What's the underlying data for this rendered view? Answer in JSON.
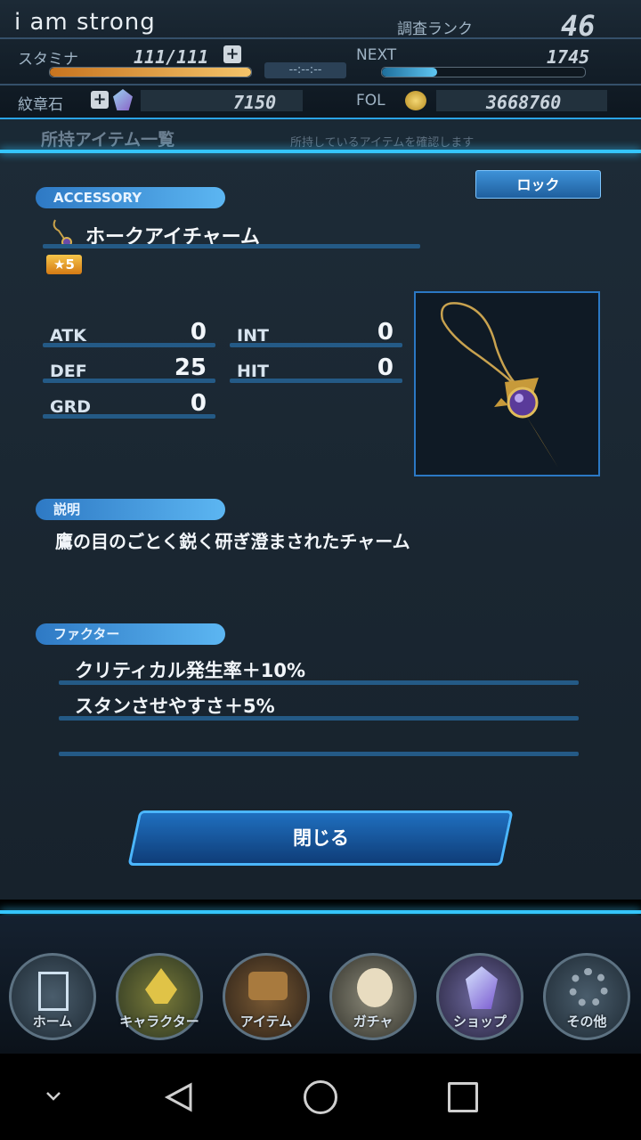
{
  "header": {
    "player_name": "i am strong",
    "rank_label": "調査ランク",
    "rank_value": "46",
    "stamina_label": "スタミナ",
    "stamina_value": "111/111",
    "next_label": "NEXT",
    "next_value": "1745",
    "timer": "--:--:--",
    "crest_label": "紋章石",
    "crest_value": "7150",
    "fol_label": "FOL",
    "fol_value": "3668760",
    "bg_title": "所持アイテム一覧",
    "bg_hint": "所持しているアイテムを確認します"
  },
  "item": {
    "category": "ACCESSORY",
    "name": "ホークアイチャーム",
    "rarity": "5",
    "lock_label": "ロック",
    "stats": {
      "atk_label": "ATK",
      "atk": "0",
      "int_label": "INT",
      "int": "0",
      "def_label": "DEF",
      "def": "25",
      "hit_label": "HIT",
      "hit": "0",
      "grd_label": "GRD",
      "grd": "0"
    },
    "desc_label": "説明",
    "description": "鷹の目のごとく鋭く研ぎ澄まされたチャーム",
    "factor_label": "ファクター",
    "factors": [
      "クリティカル発生率＋10%",
      "スタンさせやすさ＋5%",
      ""
    ],
    "close_label": "閉じる"
  },
  "nav": {
    "items": [
      {
        "label": "ホーム"
      },
      {
        "label": "キャラクター"
      },
      {
        "label": "アイテム"
      },
      {
        "label": "ガチャ"
      },
      {
        "label": "ショップ"
      },
      {
        "label": "その他"
      }
    ]
  },
  "colors": {
    "accent": "#35c6ff",
    "panel": "#1d2b37"
  }
}
